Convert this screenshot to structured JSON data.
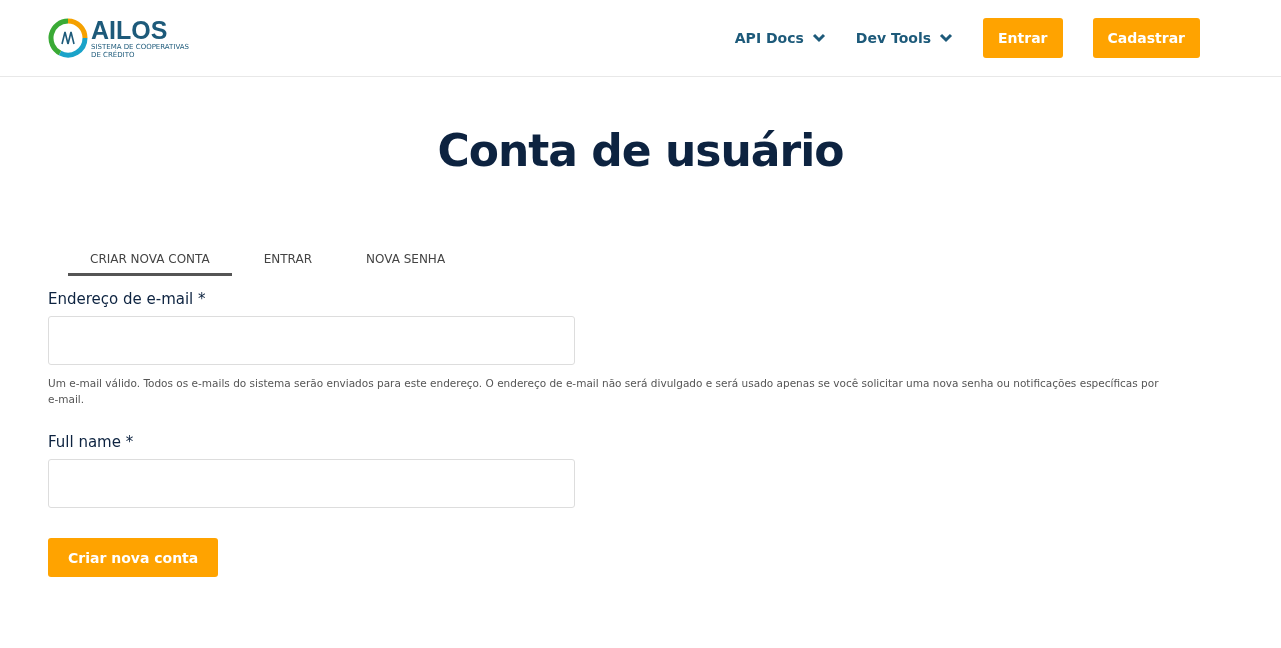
{
  "header": {
    "logo": {
      "name": "AILOS",
      "subtitle": [
        "SISTEMA DE COOPERATIVAS",
        "DE CRÉDITO"
      ]
    },
    "nav": [
      {
        "label": "API Docs",
        "kind": "dropdown"
      },
      {
        "label": "Dev Tools",
        "kind": "dropdown"
      },
      {
        "label": "Entrar",
        "kind": "button"
      },
      {
        "label": "Cadastrar",
        "kind": "button"
      }
    ]
  },
  "title": "Conta de usuário",
  "tabs": [
    {
      "label": "CRIAR NOVA CONTA",
      "selected": true
    },
    {
      "label": "ENTRAR",
      "selected": false
    },
    {
      "label": "NOVA SENHA",
      "selected": false
    }
  ],
  "fields": [
    {
      "label": "Endereço de e-mail *",
      "help": "Um e-mail válido. Todos os e-mails do sistema serão enviados para este endereço. O endereço de e-mail não será divulgado e será usado apenas se você solicitar uma nova senha ou notificações específicas por e-mail."
    },
    {
      "label": "Full name *"
    }
  ],
  "submit": "Criar nova conta"
}
